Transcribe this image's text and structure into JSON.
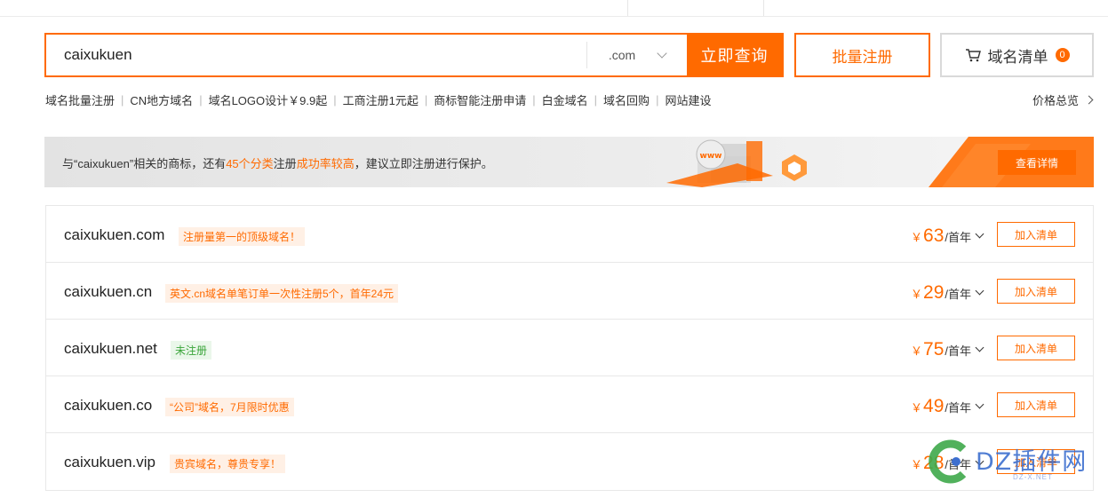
{
  "search": {
    "query": "caixukuen",
    "suffix": ".com",
    "button_label": "立即查询"
  },
  "bulk_register_label": "批量注册",
  "cart": {
    "label": "域名清单",
    "count": "0"
  },
  "quick_links": [
    "域名批量注册",
    "CN地方域名",
    "域名LOGO设计￥9.9起",
    "工商注册1元起",
    "商标智能注册申请",
    "白金域名",
    "域名回购",
    "网站建设"
  ],
  "price_overview_label": "价格总览",
  "banner": {
    "text_1": "与“caixukuen”相关的商标，还有",
    "highlight_1": "45个分类",
    "text_2": "注册",
    "highlight_2": "成功率较高",
    "text_3": "，建议立即注册进行保护。",
    "button_label": "查看详情",
    "art_text": "www"
  },
  "results": [
    {
      "domain": "caixukuen.com",
      "tag": "注册量第一的顶级域名！",
      "tag_style": "orange",
      "currency": "￥",
      "price": "63",
      "unit": "/首年",
      "add_label": "加入清单"
    },
    {
      "domain": "caixukuen.cn",
      "tag": "英文.cn域名单笔订单一次性注册5个，首年24元",
      "tag_style": "orange",
      "currency": "￥",
      "price": "29",
      "unit": "/首年",
      "add_label": "加入清单"
    },
    {
      "domain": "caixukuen.net",
      "tag": "未注册",
      "tag_style": "green",
      "currency": "￥",
      "price": "75",
      "unit": "/首年",
      "add_label": "加入清单"
    },
    {
      "domain": "caixukuen.co",
      "tag": "“公司”域名，7月限时优惠",
      "tag_style": "orange",
      "currency": "￥",
      "price": "49",
      "unit": "/首年",
      "add_label": "加入清单"
    },
    {
      "domain": "caixukuen.vip",
      "tag": "贵宾域名，尊贵专享！",
      "tag_style": "orange",
      "currency": "￥",
      "price": "28",
      "unit": "/首年",
      "add_label": "加入清单"
    }
  ],
  "watermark": {
    "text": "DZ插件网",
    "sub": "DZ-X.NET"
  },
  "colors": {
    "accent": "#ff6a00",
    "green": "#3aa53a",
    "watermark": "#3d6fcf"
  }
}
